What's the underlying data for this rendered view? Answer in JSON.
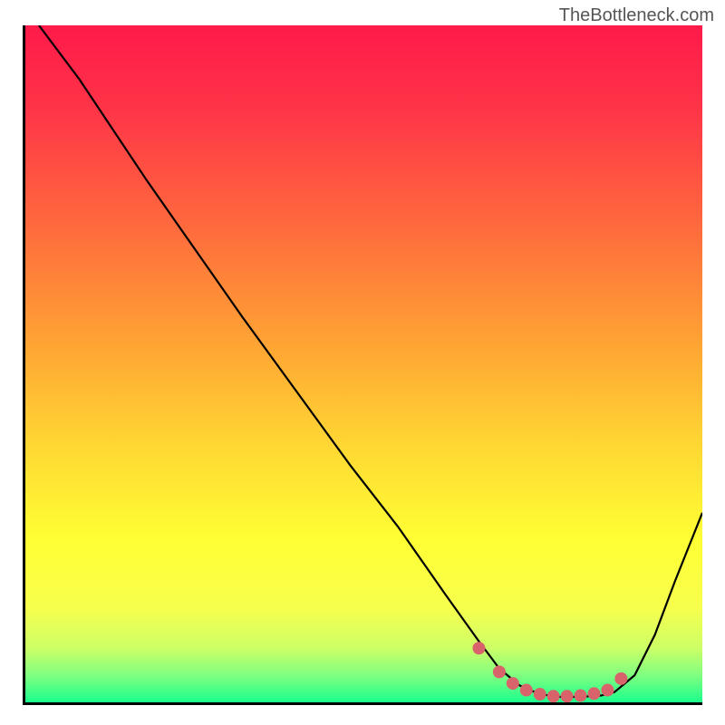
{
  "watermark": "TheBottleneck.com",
  "chart_data": {
    "type": "line",
    "title": "",
    "xlabel": "",
    "ylabel": "",
    "xlim": [
      0,
      100
    ],
    "ylim": [
      0,
      100
    ],
    "series": [
      {
        "name": "curve",
        "color": "#000000",
        "x": [
          2,
          5,
          8,
          12,
          18,
          25,
          32,
          40,
          48,
          55,
          62,
          67,
          70,
          73,
          76,
          79,
          82,
          85,
          87,
          90,
          93,
          96,
          100
        ],
        "y": [
          100,
          96,
          92,
          86,
          77,
          67,
          57,
          46,
          35,
          26,
          16,
          9,
          5,
          2.5,
          1.2,
          0.8,
          0.8,
          1,
          1.5,
          4,
          10,
          18,
          28
        ]
      },
      {
        "name": "highlight-dots",
        "color": "#d9636b",
        "x": [
          67,
          70,
          72,
          74,
          76,
          78,
          80,
          82,
          84,
          86,
          88
        ],
        "y": [
          8,
          4.5,
          2.8,
          1.8,
          1.2,
          0.9,
          0.9,
          1,
          1.3,
          1.8,
          3.5
        ]
      }
    ],
    "background_gradient": {
      "stops": [
        {
          "offset": 0,
          "color": "#ff1a4a"
        },
        {
          "offset": 0.12,
          "color": "#ff3348"
        },
        {
          "offset": 0.3,
          "color": "#ff6b3d"
        },
        {
          "offset": 0.48,
          "color": "#ffa733"
        },
        {
          "offset": 0.62,
          "color": "#ffd733"
        },
        {
          "offset": 0.76,
          "color": "#ffff33"
        },
        {
          "offset": 0.86,
          "color": "#f7ff4d"
        },
        {
          "offset": 0.92,
          "color": "#ccff66"
        },
        {
          "offset": 0.96,
          "color": "#80ff80"
        },
        {
          "offset": 1.0,
          "color": "#1aff8c"
        }
      ]
    }
  }
}
